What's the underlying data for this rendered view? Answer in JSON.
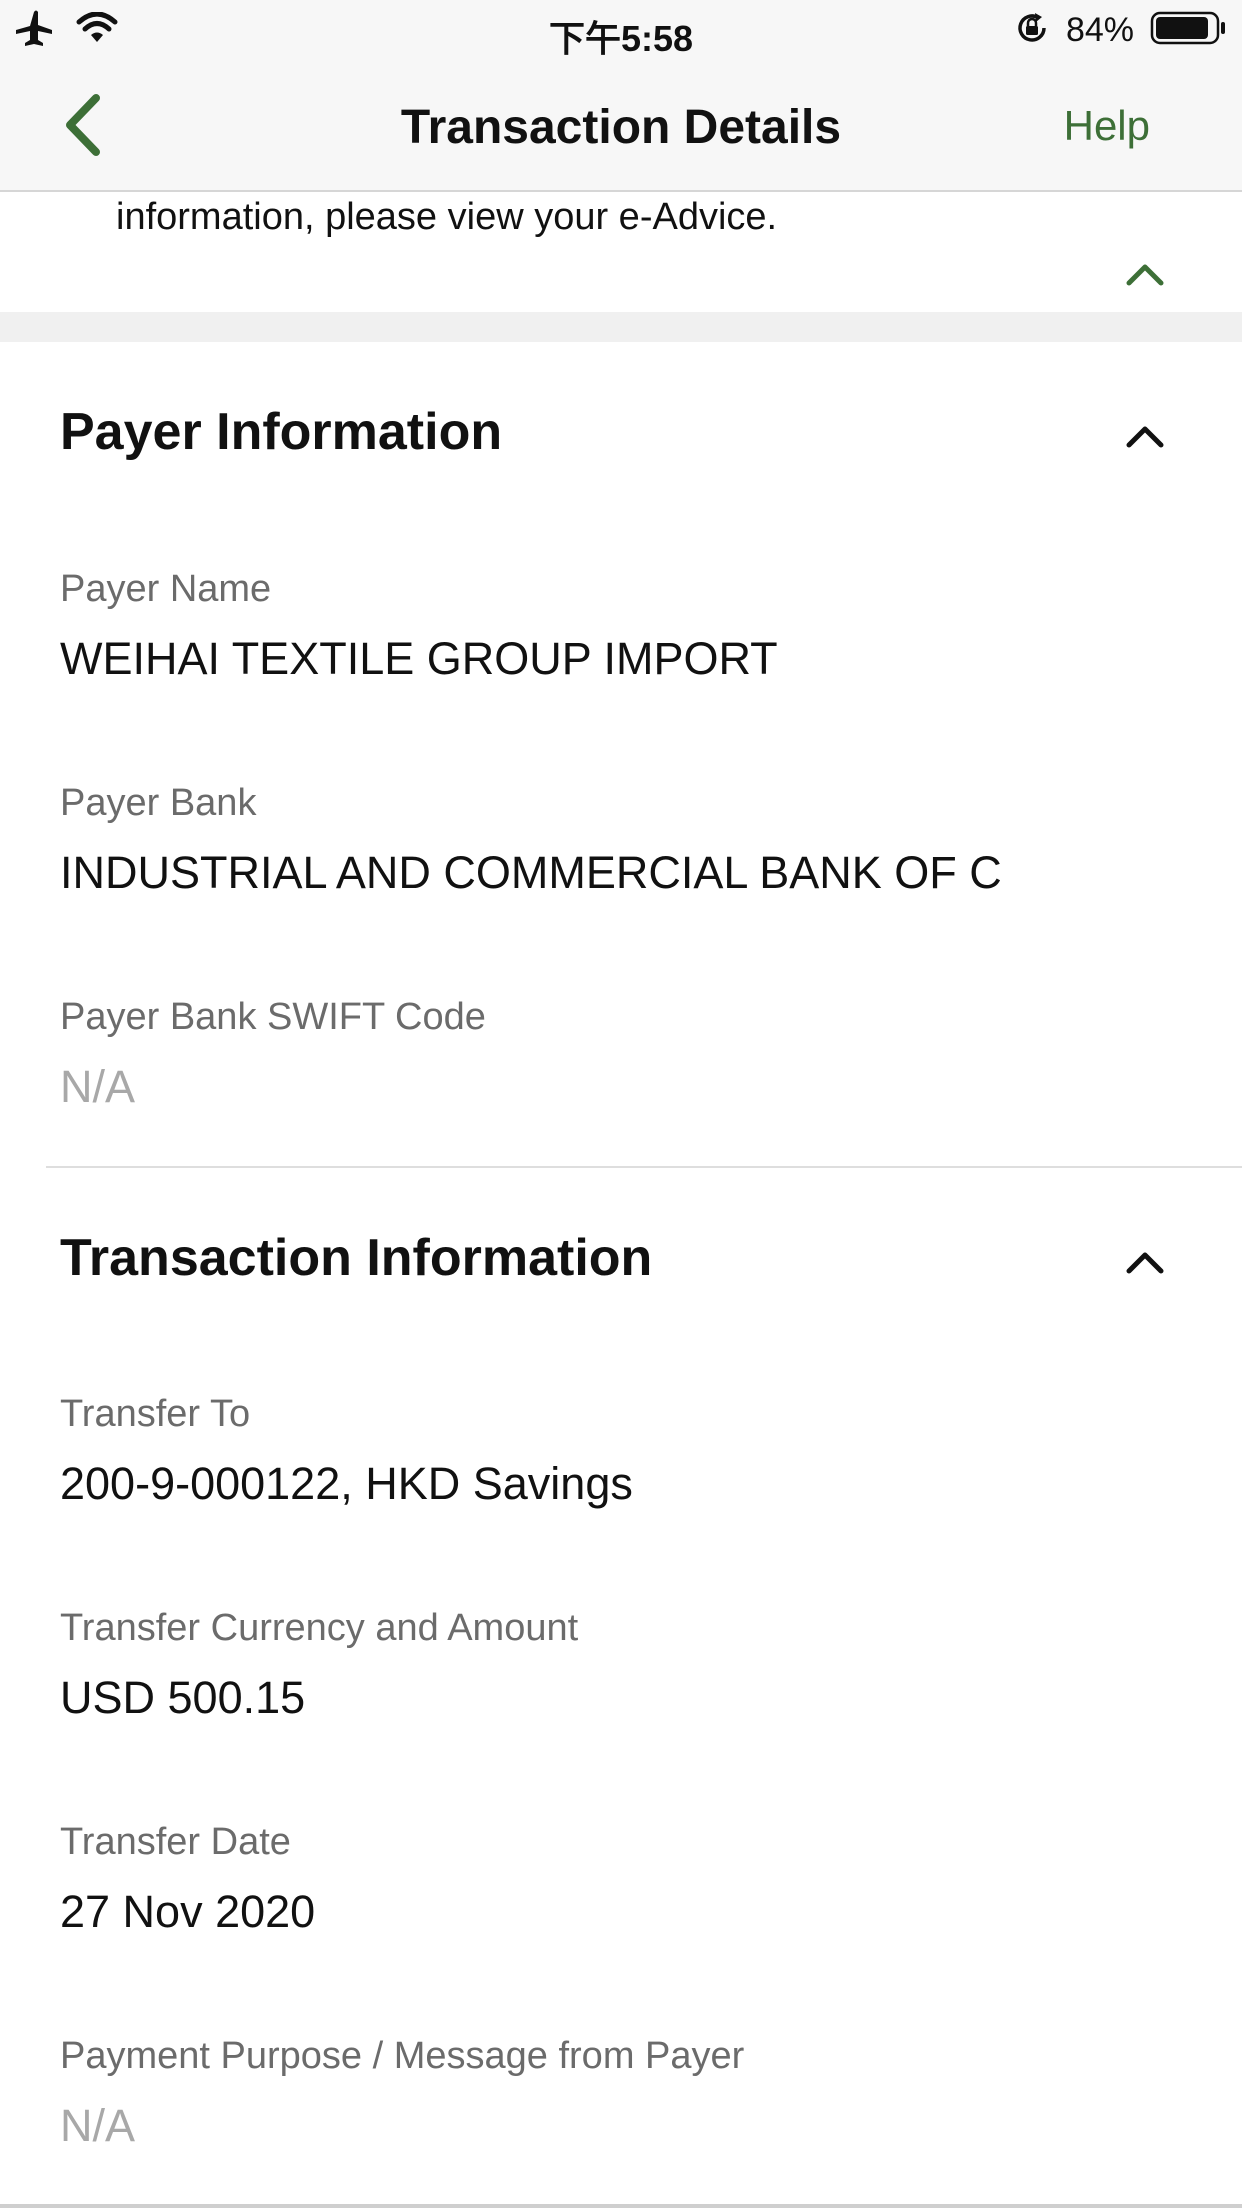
{
  "status_bar": {
    "time": "下午5:58",
    "battery_percent": "84%",
    "icons": [
      "airplane-icon",
      "wifi-icon",
      "rotation-lock-icon",
      "battery-icon"
    ]
  },
  "nav": {
    "title": "Transaction Details",
    "help_label": "Help",
    "back_icon": "chevron-left-icon"
  },
  "notice": {
    "text": "information, please view your e-Advice."
  },
  "payer_section": {
    "title": "Payer Information",
    "fields": [
      {
        "label": "Payer Name",
        "value": "WEIHAI TEXTILE GROUP IMPORT"
      },
      {
        "label": "Payer Bank",
        "value": "INDUSTRIAL AND COMMERCIAL BANK OF C"
      },
      {
        "label": "Payer Bank SWIFT Code",
        "value": "N/A"
      }
    ]
  },
  "transaction_section": {
    "title": "Transaction Information",
    "fields": [
      {
        "label": "Transfer To",
        "value": "200-9-000122, HKD Savings"
      },
      {
        "label": "Transfer Currency and Amount",
        "value": "USD 500.15"
      },
      {
        "label": "Transfer Date",
        "value": "27 Nov 2020"
      },
      {
        "label": "Payment Purpose / Message from Payer",
        "value": "N/A"
      }
    ]
  },
  "colors": {
    "accent": "#3d6f37",
    "label": "#6b6b6b",
    "empty_value": "#a8a8a8",
    "bar_background": "#f7f7f7"
  }
}
